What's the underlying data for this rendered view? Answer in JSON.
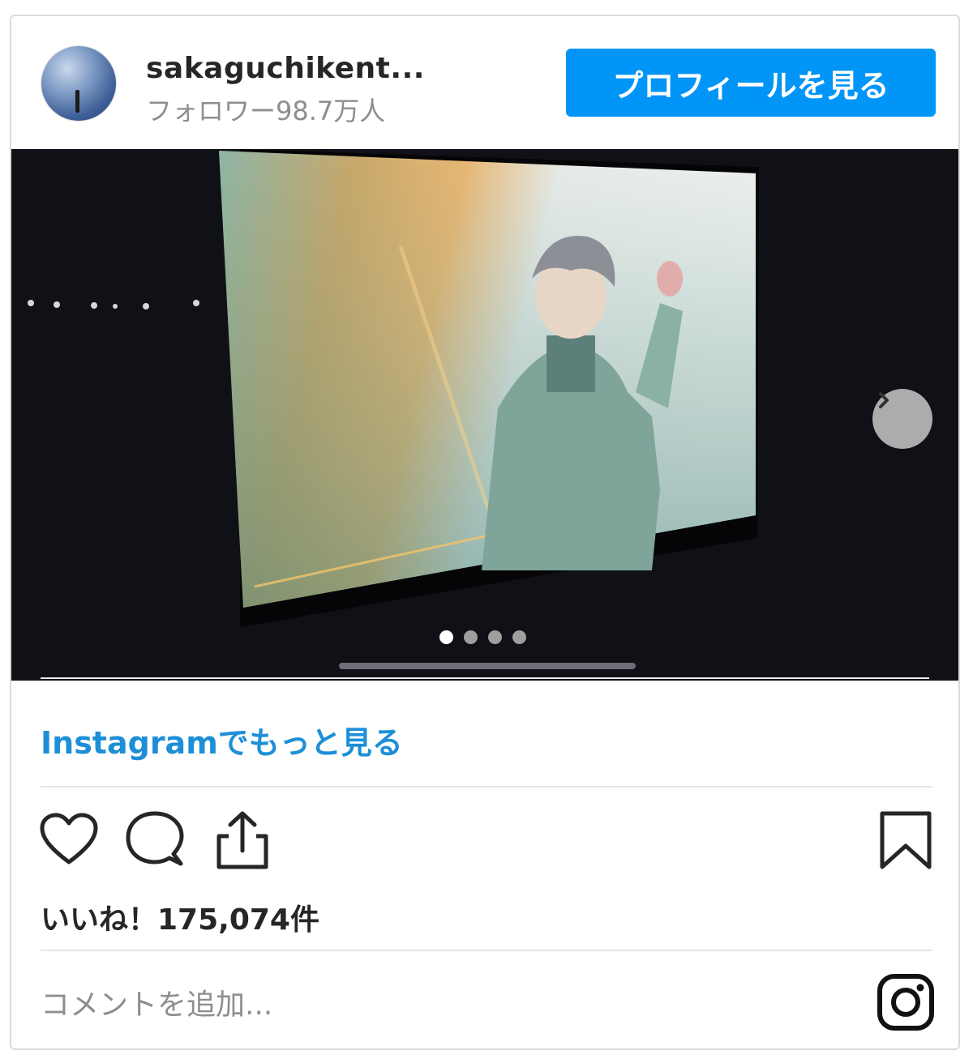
{
  "header": {
    "username": "sakaguchikent...",
    "followers": "フォロワー98.7万人",
    "profile_button_label": "プロフィールを見る"
  },
  "media": {
    "slide_count": 4,
    "active_slide": 1,
    "next_icon": "chevron-right-icon"
  },
  "more_link_label": "Instagramでもっと見る",
  "actions": {
    "like_icon": "heart-icon",
    "comment_icon": "comment-icon",
    "share_icon": "share-icon",
    "save_icon": "bookmark-icon"
  },
  "likes_text": "いいね！175,074件",
  "comment": {
    "placeholder": "コメントを追加...",
    "brand_icon": "instagram-icon"
  },
  "colors": {
    "accent": "#0095f6",
    "link": "#1d8fd6",
    "muted": "#8e8e8e",
    "text": "#262626"
  }
}
